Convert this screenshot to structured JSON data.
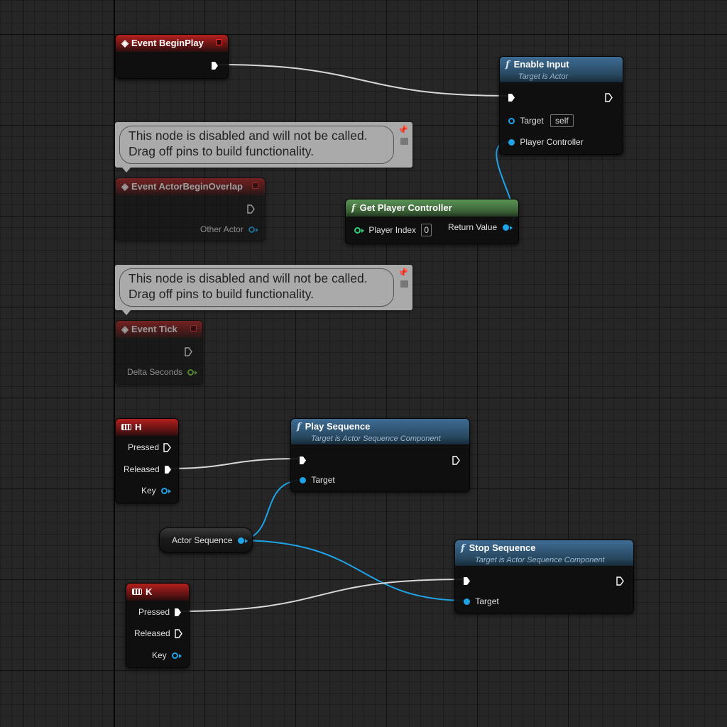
{
  "graph": {
    "event_begin_play": {
      "title": "Event BeginPlay"
    },
    "enable_input": {
      "title": "Enable Input",
      "subtitle": "Target is Actor",
      "target_label": "Target",
      "target_value": "self",
      "player_controller_label": "Player Controller"
    },
    "comment_1": {
      "line1": "This node is disabled and will not be called.",
      "line2": "Drag off pins to build functionality."
    },
    "event_actor_begin_overlap": {
      "title": "Event ActorBeginOverlap",
      "other_actor_label": "Other Actor"
    },
    "get_player_controller": {
      "title": "Get Player Controller",
      "player_index_label": "Player Index",
      "player_index_value": "0",
      "return_value_label": "Return Value"
    },
    "comment_2": {
      "line1": "This node is disabled and will not be called.",
      "line2": "Drag off pins to build functionality."
    },
    "event_tick": {
      "title": "Event Tick",
      "delta_seconds_label": "Delta Seconds"
    },
    "key_h": {
      "title": "H",
      "pressed": "Pressed",
      "released": "Released",
      "key": "Key"
    },
    "play_sequence": {
      "title": "Play Sequence",
      "subtitle": "Target is Actor Sequence Component",
      "target_label": "Target"
    },
    "actor_sequence": {
      "label": "Actor Sequence"
    },
    "stop_sequence": {
      "title": "Stop Sequence",
      "subtitle": "Target is Actor Sequence Component",
      "target_label": "Target"
    },
    "key_k": {
      "title": "K",
      "pressed": "Pressed",
      "released": "Released",
      "key": "Key"
    }
  },
  "colors": {
    "exec_wire": "#d8d8d8",
    "object_wire": "#1fa3e8",
    "event_header": "#b3201e",
    "function_header": "#3e6c94",
    "pure_function_header": "#5c9456"
  }
}
